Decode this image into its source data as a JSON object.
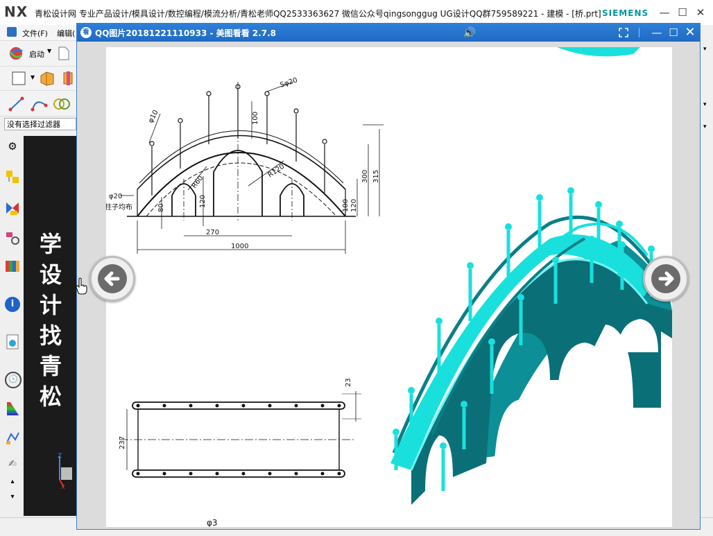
{
  "nx": {
    "logo": "NX",
    "title": "青松设计网 专业产品设计/模具设计/数控编程/模流分析/青松老师QQ2533363627 微信公众号qingsonggug UG设计QQ群759589221 - 建模 - [桥.prt]",
    "brand": "SIEMENS",
    "menu_file": "文件(F)",
    "menu_edit": "编辑(",
    "start_label": "启动",
    "filter_label": "没有选择过滤器",
    "watermark": [
      "学",
      "设",
      "计",
      "找",
      "青",
      "松"
    ]
  },
  "viewer": {
    "title": "QQ图片20181221110933 - 美图看看 2.7.8",
    "logo": "看"
  },
  "drawing": {
    "dims": {
      "sphere": "Sφ20",
      "rail_dia": "φ10",
      "post_height": "100",
      "r_small": "R60",
      "r_big": "R120",
      "right_300": "300",
      "right_315": "315",
      "right_100": "100",
      "right_120": "120",
      "post_dia": "φ20",
      "post_note": "柱子均布",
      "height_80": "80",
      "height_120": "120",
      "span_270": "270",
      "span_1000": "1000",
      "plan_23": "23",
      "plan_237": "237",
      "bottom_note": "φ3"
    }
  },
  "colors": {
    "viewer_title_bg": "#1f6bc2",
    "bridge_cyan": "#19e0dc",
    "bridge_shadow": "#0e7d86",
    "siemens": "#0098a0"
  }
}
